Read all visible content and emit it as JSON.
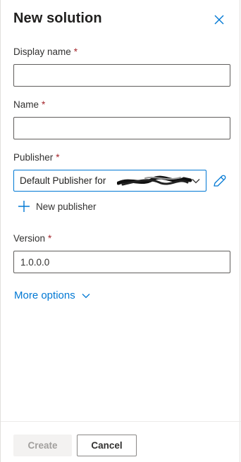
{
  "dialog": {
    "title": "New solution"
  },
  "fields": {
    "display_name": {
      "label": "Display name",
      "required_mark": "*",
      "value": ""
    },
    "name": {
      "label": "Name",
      "required_mark": "*",
      "value": ""
    },
    "publisher": {
      "label": "Publisher",
      "required_mark": "*",
      "selected_value": "Default Publisher for",
      "new_publisher_label": "New publisher"
    },
    "version": {
      "label": "Version",
      "required_mark": "*",
      "value": "1.0.0.0"
    }
  },
  "more_options_label": "More options",
  "footer": {
    "create_label": "Create",
    "cancel_label": "Cancel"
  },
  "colors": {
    "accent": "#0078d4",
    "required": "#a4262c",
    "disabled_text": "#a19f9d"
  },
  "icons": [
    "close-icon",
    "chevron-down-icon",
    "pencil-icon",
    "plus-icon",
    "redaction-scribble"
  ]
}
